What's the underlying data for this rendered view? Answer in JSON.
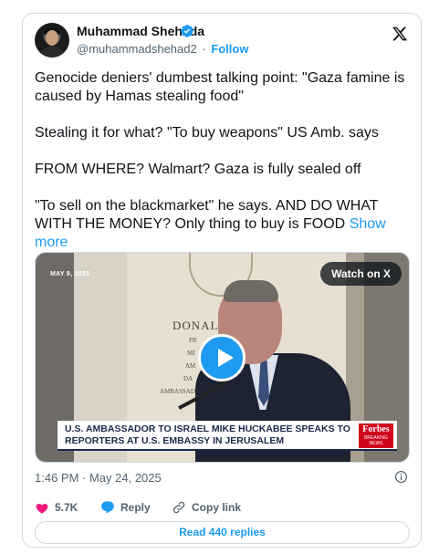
{
  "author": {
    "name": "Muhammad Shehada",
    "handle": "@muhammadshehad2",
    "separator": "·",
    "follow_label": "Follow",
    "verified": true
  },
  "brand": {
    "logo": "x-logo-icon"
  },
  "tweet": {
    "paragraphs": [
      "Genocide deniers' dumbest talking point: \"Gaza famine is caused by Hamas stealing food\"",
      "Stealing it for what? \"To buy weapons\" US Amb. says",
      "FROM WHERE? Walmart? Gaza is fully sealed off",
      "\"To sell on the blackmarket\" he says. AND DO WHAT WITH THE MONEY? Only thing to buy is FOOD"
    ],
    "show_more_label": "Show more"
  },
  "video": {
    "date_tag": "MAY 9, 2026",
    "watch_label": "Watch on X",
    "plaque_name": "DONALD",
    "plaque_lines": [
      "PR",
      "MI",
      "AM",
      "DA",
      "AMBASSADOR"
    ],
    "banner_text": "U.S. AMBASSADOR TO ISRAEL MIKE HUCKABEE SPEAKS TO REPORTERS AT U.S. EMBASSY IN JERUSALEM",
    "network_logo": "Forbes",
    "network_sub": "BREAKING NEWS"
  },
  "meta": {
    "timestamp": "1:46 PM · May 24, 2025"
  },
  "actions": {
    "likes": "5.7K",
    "reply_label": "Reply",
    "copy_link_label": "Copy link"
  },
  "read_replies_label": "Read 440 replies",
  "colors": {
    "accent": "#1d9bf0",
    "like": "#f91880",
    "text": "#0f1419",
    "secondary": "#536471",
    "border": "#cfd9de"
  }
}
